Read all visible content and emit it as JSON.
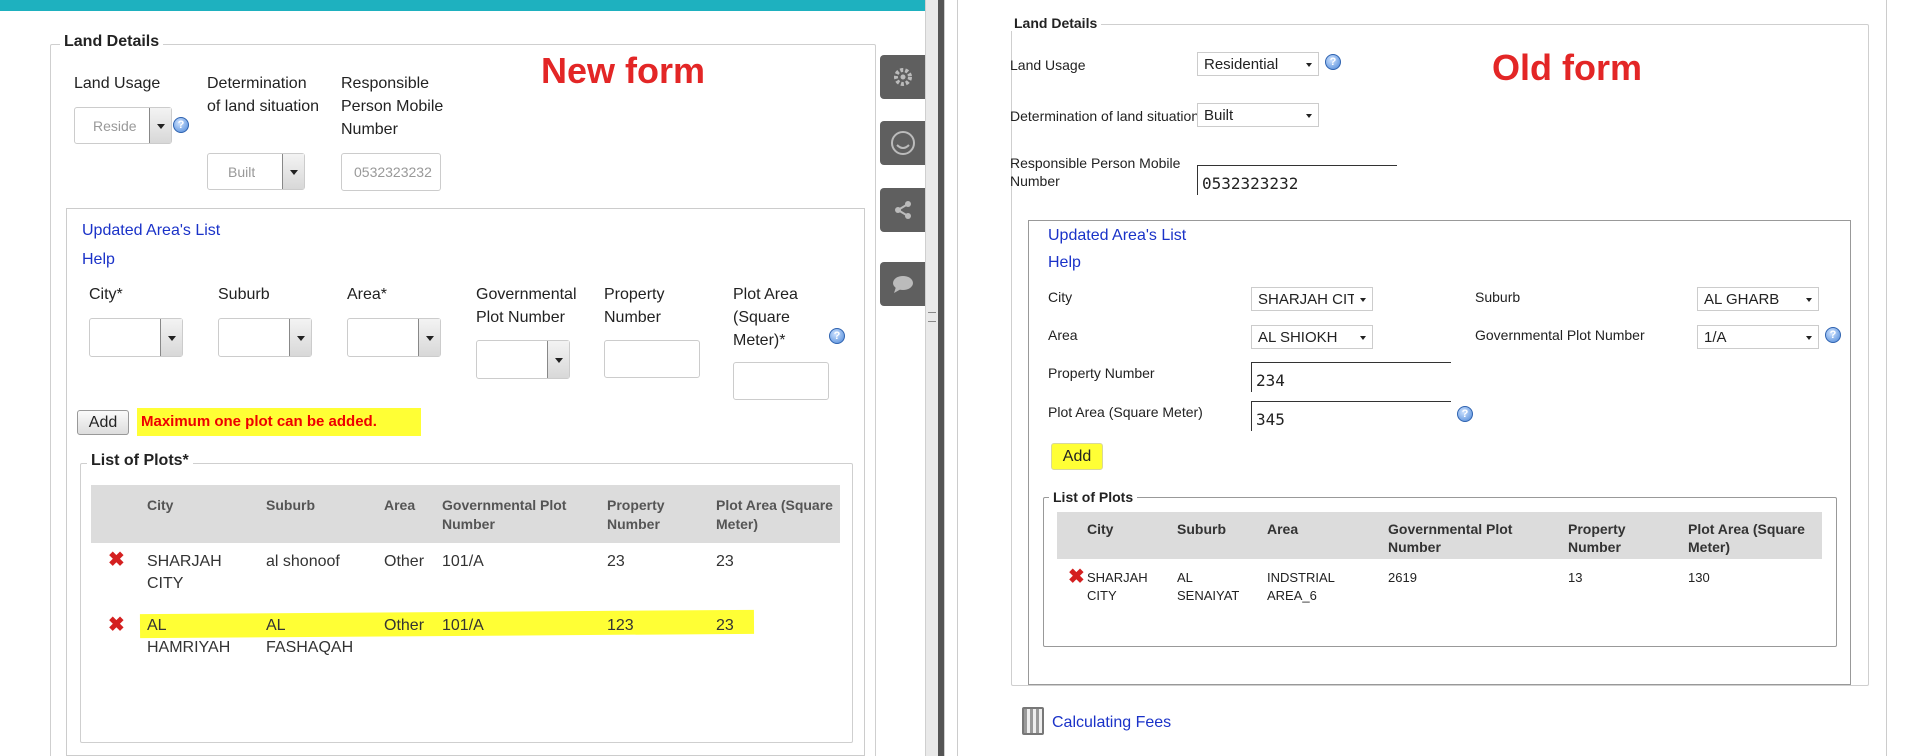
{
  "new_form": {
    "heading": "New form",
    "legend": "Land Details",
    "fields": {
      "land_usage_label": "Land Usage",
      "land_usage_value": "Reside",
      "determination_label": "Determination of land situation",
      "determination_value": "Built",
      "mobile_label": "Responsible Person Mobile Number",
      "mobile_value": "0532323232"
    },
    "links": {
      "updated_areas": "Updated Area's List",
      "help": "Help"
    },
    "plot_fields": {
      "city": "City*",
      "suburb": "Suburb",
      "area": "Area*",
      "gov_plot": "Governmental Plot Number",
      "property": "Property Number",
      "plot_area": "Plot Area (Square Meter)*"
    },
    "add_button": "Add",
    "warning": "Maximum one plot can be added.",
    "plots_legend": "List of Plots*",
    "table": {
      "headers": [
        "City",
        "Suburb",
        "Area",
        "Governmental Plot Number",
        "Property Number",
        "Plot Area (Square Meter)"
      ],
      "rows": [
        [
          "SHARJAH CITY",
          "al shonoof",
          "Other",
          "101/A",
          "23",
          "23"
        ],
        [
          "AL HAMRIYAH",
          "AL FASHAQAH",
          "Other",
          "101/A",
          "123",
          "23"
        ]
      ]
    }
  },
  "old_form": {
    "heading": "Old form",
    "legend": "Land Details",
    "fields": {
      "land_usage_label": "Land Usage",
      "land_usage_value": "Residential",
      "determination_label": "Determination of land situation",
      "determination_value": "Built",
      "mobile_label": "Responsible Person Mobile Number",
      "mobile_value": "0532323232"
    },
    "links": {
      "updated_areas": "Updated Area's List",
      "help": "Help",
      "calc_fees": "Calculating Fees"
    },
    "plot_fields": {
      "city_label": "City",
      "city_value": "SHARJAH CIT",
      "suburb_label": "Suburb",
      "suburb_value": "AL GHARB",
      "area_label": "Area",
      "area_value": "AL SHIOKH",
      "gov_label": "Governmental Plot Number",
      "gov_value": "1/A",
      "property_label": "Property Number",
      "property_value": "234",
      "plot_area_label": "Plot Area (Square Meter)",
      "plot_area_value": "345"
    },
    "add_button": "Add",
    "plots_legend": "List of Plots",
    "table": {
      "headers": [
        "City",
        "Suburb",
        "Area",
        "Governmental Plot Number",
        "Property Number",
        "Plot Area (Square Meter)"
      ],
      "rows": [
        [
          "SHARJAH CITY",
          "AL SENAIYAT",
          "INDSTRIAL AREA_6",
          "2619",
          "13",
          "130"
        ]
      ]
    }
  },
  "colors": {
    "accent": "#1eb1bf",
    "heading": "#e32626",
    "link": "#1a32c8",
    "highlight": "#ffff35"
  }
}
